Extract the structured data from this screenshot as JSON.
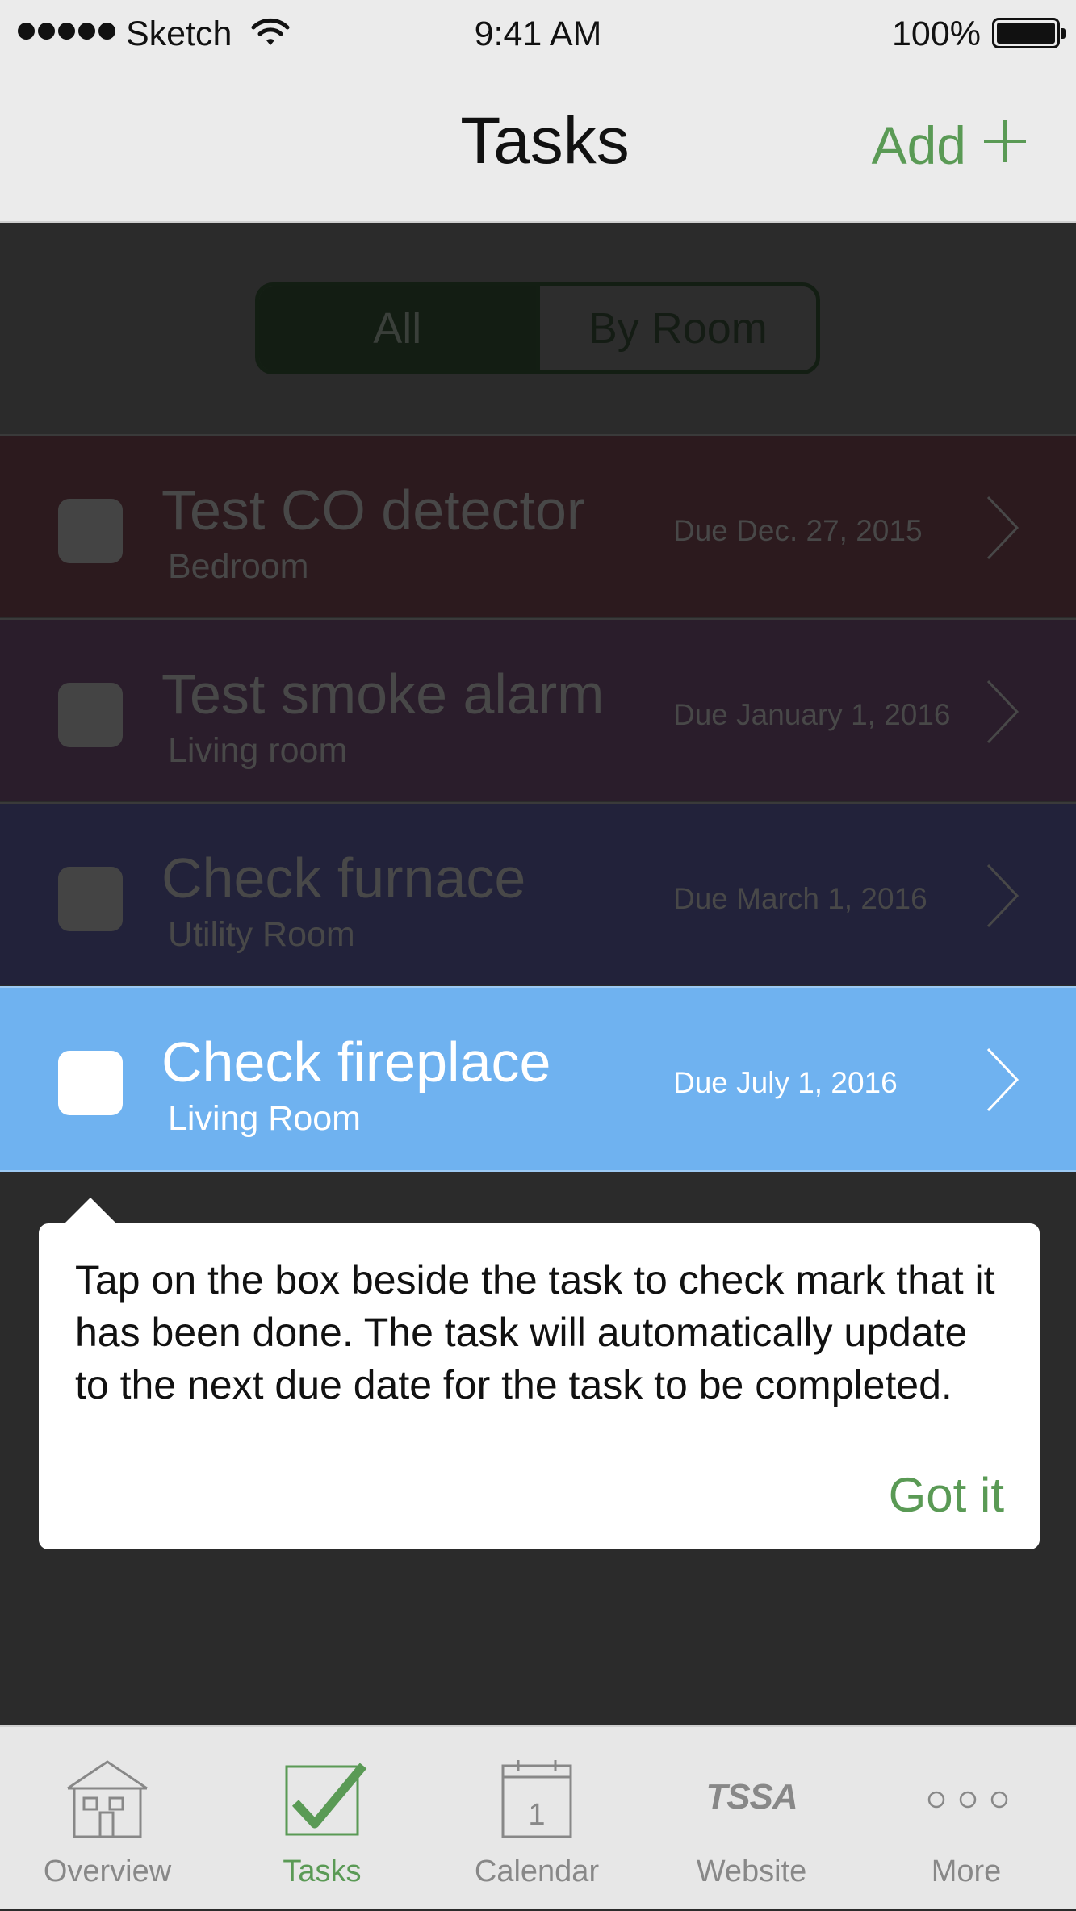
{
  "status_bar": {
    "carrier": "Sketch",
    "time": "9:41 AM",
    "battery": "100%"
  },
  "nav": {
    "title": "Tasks",
    "add_label": "Add"
  },
  "segment": {
    "options": [
      "All",
      "By Room"
    ],
    "selected": "All"
  },
  "tasks": [
    {
      "title": "Test CO detector",
      "room": "Bedroom",
      "due": "Due Dec. 27, 2015",
      "color": "#2c1a1e"
    },
    {
      "title": "Test smoke alarm",
      "room": "Living room",
      "due": "Due January 1, 2016",
      "color": "#2a1d2b"
    },
    {
      "title": "Check furnace",
      "room": "Utility Room",
      "due": "Due March 1, 2016",
      "color": "#22223a"
    },
    {
      "title": "Check fireplace",
      "room": "Living Room",
      "due": "Due July 1, 2016",
      "color": "#6fb2f0",
      "highlighted": true
    }
  ],
  "tooltip": {
    "text": "Tap on the box beside the task to check mark that it has been done.  The task will automatically update to the next due date for the task to be completed.",
    "button": "Got it"
  },
  "tabbar": {
    "items": [
      {
        "label": "Overview",
        "icon": "house-icon"
      },
      {
        "label": "Tasks",
        "icon": "checkbox-icon",
        "active": true
      },
      {
        "label": "Calendar",
        "icon": "calendar-icon",
        "calendar_day": "1"
      },
      {
        "label": "Website",
        "icon": "tssa-logo-icon",
        "logo_text": "TSSA"
      },
      {
        "label": "More",
        "icon": "more-dots-icon"
      }
    ]
  },
  "colors": {
    "accent_green": "#5a9a55",
    "highlight_blue": "#6fb2f0",
    "overlay_bg": "#2b2b2b"
  }
}
